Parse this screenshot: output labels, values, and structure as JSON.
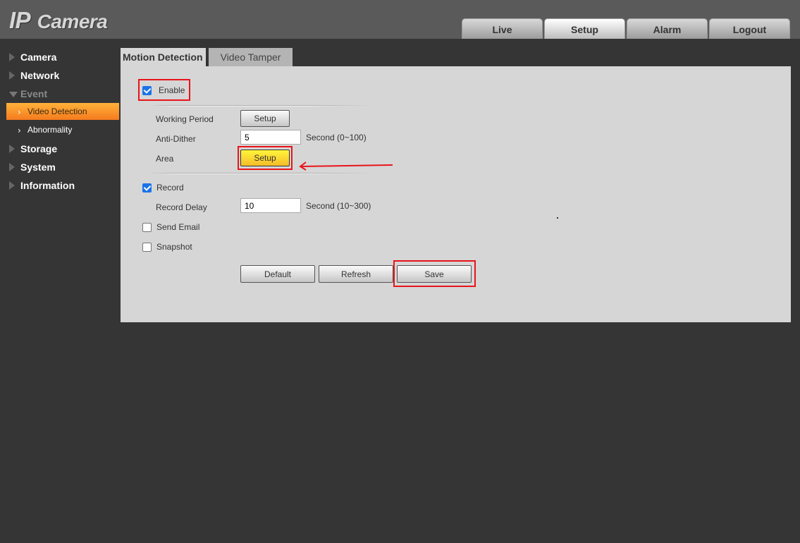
{
  "header": {
    "logo_ip": "IP",
    "logo_camera": "Camera",
    "tabs": [
      {
        "label": "Live",
        "active": false
      },
      {
        "label": "Setup",
        "active": true
      },
      {
        "label": "Alarm",
        "active": false
      },
      {
        "label": "Logout",
        "active": false
      }
    ]
  },
  "sidebar": {
    "items": [
      {
        "label": "Camera",
        "icon": "triangle-right-icon"
      },
      {
        "label": "Network",
        "icon": "triangle-right-icon"
      },
      {
        "label": "Event",
        "icon": "triangle-down-icon",
        "expanded": true,
        "children": [
          {
            "label": "Video Detection",
            "icon": "chevron-right-icon",
            "active": true
          },
          {
            "label": "Abnormality",
            "icon": "chevron-right-icon",
            "active": false
          }
        ]
      },
      {
        "label": "Storage",
        "icon": "triangle-right-icon"
      },
      {
        "label": "System",
        "icon": "triangle-right-icon"
      },
      {
        "label": "Information",
        "icon": "triangle-right-icon"
      }
    ]
  },
  "content_tabs": [
    {
      "label": "Motion Detection",
      "active": true
    },
    {
      "label": "Video Tamper",
      "active": false
    }
  ],
  "form": {
    "enable": {
      "label": "Enable",
      "checked": true
    },
    "working_period": {
      "label": "Working Period",
      "button": "Setup"
    },
    "anti_dither": {
      "label": "Anti-Dither",
      "value": "5",
      "unit": "Second (0~100)"
    },
    "area": {
      "label": "Area",
      "button": "Setup"
    },
    "record": {
      "label": "Record",
      "checked": true
    },
    "record_delay": {
      "label": "Record Delay",
      "value": "10",
      "unit": "Second (10~300)"
    },
    "send_email": {
      "label": "Send Email",
      "checked": false
    },
    "snapshot": {
      "label": "Snapshot",
      "checked": false
    }
  },
  "actions": {
    "default_label": "Default",
    "refresh_label": "Refresh",
    "save_label": "Save"
  },
  "colors": {
    "highlight": "#e8141a",
    "active_nav": "#f57a1e",
    "area_button": "#f5bd2a",
    "checkbox": "#1a73e8"
  }
}
